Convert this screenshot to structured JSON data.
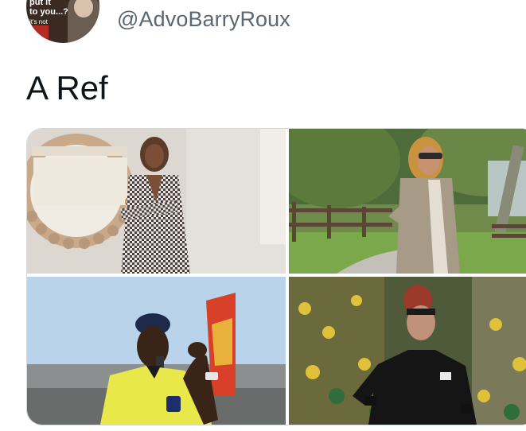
{
  "author": {
    "handle": "@AdvoBarryRoux",
    "avatar_text_1": "put it",
    "avatar_text_2": "to you...?",
    "avatar_text_3": "it's not"
  },
  "tweet": {
    "text": "A Ref"
  },
  "media": {
    "photo_count": 4,
    "photos": [
      {
        "subject": "woman-houndstooth-outfit-mirror"
      },
      {
        "subject": "woman-sunglasses-park-fence"
      },
      {
        "subject": "referee-yellow-kit-whistle"
      },
      {
        "subject": "referee-black-kit-stadium"
      }
    ],
    "badge_text": "FIFA"
  }
}
